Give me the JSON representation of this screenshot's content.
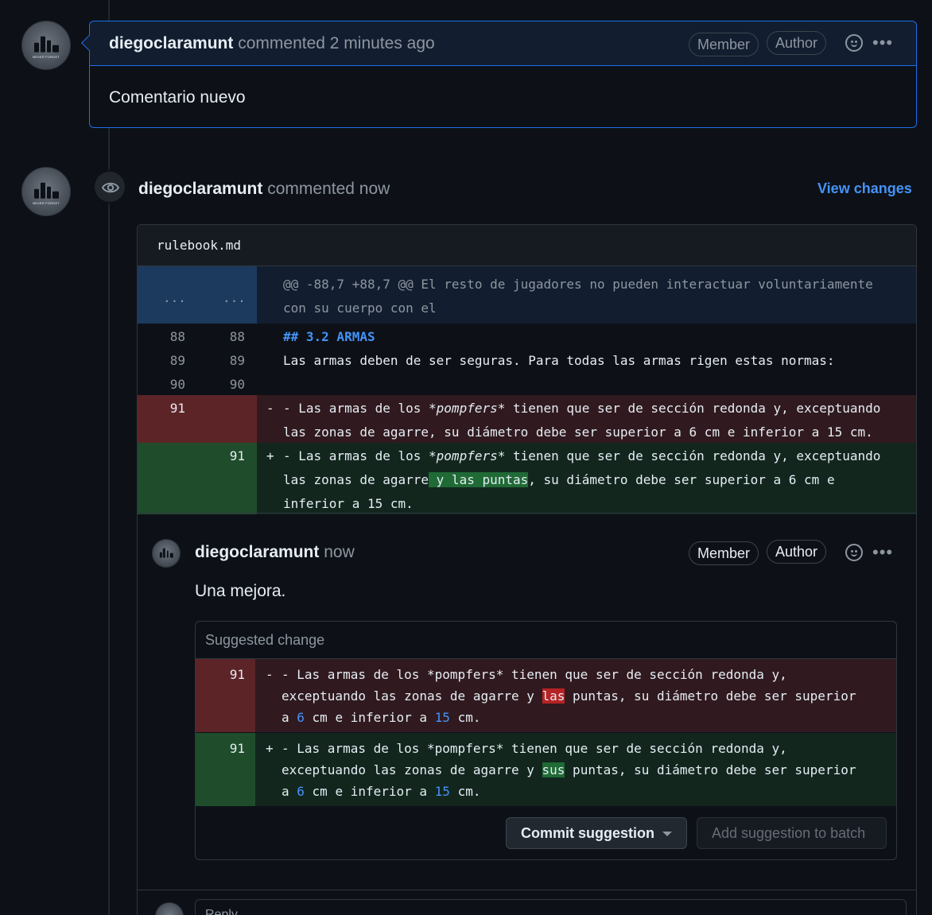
{
  "comment1": {
    "author": "diegoclaramunt",
    "action": "commented 2 minutes ago",
    "badges": [
      "Member",
      "Author"
    ],
    "body": "Comentario nuevo",
    "avatar_caption": "NEVER FORGET"
  },
  "review": {
    "author": "diegoclaramunt",
    "action": "commented now",
    "view_changes": "View changes",
    "avatar_caption": "NEVER FORGET"
  },
  "file": {
    "name": "rulebook.md",
    "hunk_dots": [
      "...",
      "..."
    ],
    "hunk_header": "@@ -88,7 +88,7 @@ El resto de jugadores no pueden interactuar voluntariamente con su cuerpo con el",
    "context_lines": [
      {
        "old": "88",
        "new": "88",
        "text": "## 3.2 ARMAS"
      },
      {
        "old": "89",
        "new": "89",
        "text": "Las armas deben de ser seguras. Para todas las armas rigen estas normas:"
      },
      {
        "old": "90",
        "new": "90",
        "text": ""
      }
    ],
    "deleted": {
      "old": "91",
      "sign": "-",
      "pre": "- Las armas de los ",
      "em": "*pompfers*",
      "post": " tienen que ser de sección redonda y, exceptuando",
      "line2": "las zonas de agarre, su diámetro debe ser superior a 6 cm e inferior a 15 cm."
    },
    "added": {
      "new": "91",
      "sign": "+",
      "pre": "- Las armas de los ",
      "em": "*pompfers*",
      "post": " tienen que ser de sección redonda y, exceptuando",
      "line2_pre": "las zonas de agarre",
      "line2_hl": " y las puntas",
      "line2_post": ", su diámetro debe ser superior a 6 cm e",
      "line3": "inferior a 15 cm."
    }
  },
  "inline_comment": {
    "author": "diegoclaramunt",
    "time": "now",
    "badges": [
      "Member",
      "Author"
    ],
    "body": "Una mejora.",
    "suggestion": {
      "title": "Suggested change",
      "deleted": {
        "num": "91",
        "sign": "-",
        "line1": "- Las armas de los *pompfers* tienen que ser de sección redonda y,",
        "line2_pre": "exceptuando las zonas de agarre y ",
        "line2_hl": "las",
        "line2_post": " puntas, su diámetro debe ser superior",
        "line3_a": "a ",
        "line3_n1": "6",
        "line3_b": " cm e inferior a ",
        "line3_n2": "15",
        "line3_c": " cm."
      },
      "added": {
        "num": "91",
        "sign": "+",
        "line1": "- Las armas de los *pompfers* tienen que ser de sección redonda y,",
        "line2_pre": "exceptuando las zonas de agarre y ",
        "line2_hl": "sus",
        "line2_post": " puntas, su diámetro debe ser superior",
        "line3_a": "a ",
        "line3_n1": "6",
        "line3_b": " cm e inferior a ",
        "line3_n2": "15",
        "line3_c": " cm."
      },
      "commit_button": "Commit suggestion",
      "batch_button": "Add suggestion to batch"
    }
  },
  "reply": {
    "placeholder_partial": "Reply..."
  },
  "colors": {
    "accent": "#4493f8",
    "deleted_bg": "#301a1f",
    "added_bg": "#12261e"
  }
}
